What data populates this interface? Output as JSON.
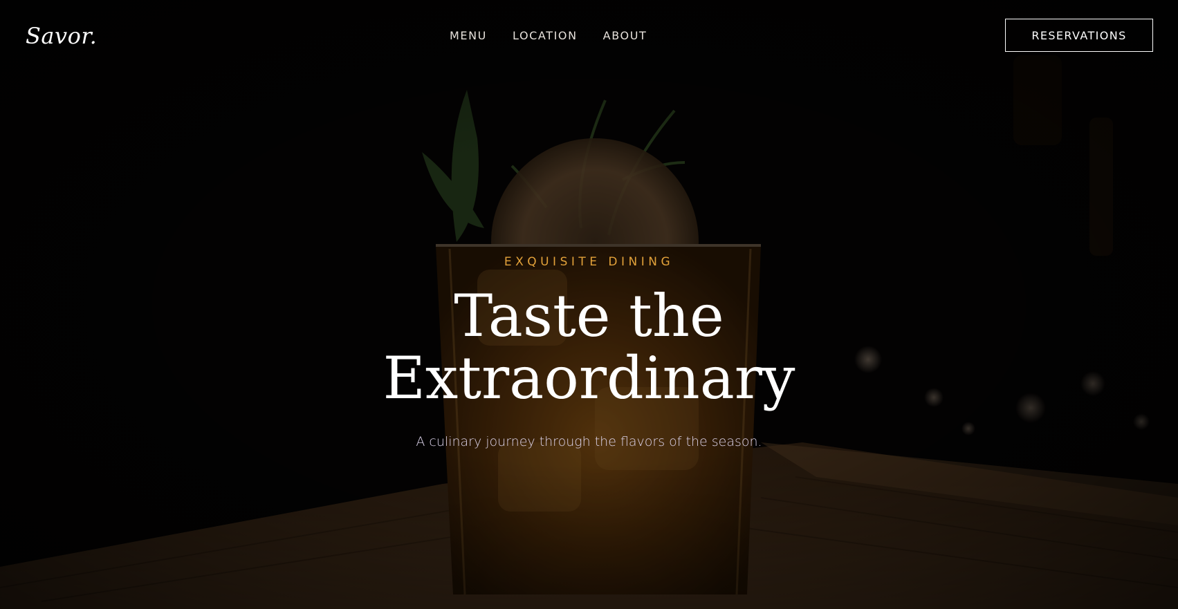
{
  "brand": {
    "logo_text": "Savor."
  },
  "nav": {
    "items": [
      {
        "label": "MENU"
      },
      {
        "label": "LOCATION"
      },
      {
        "label": "ABOUT"
      }
    ]
  },
  "header": {
    "reservations_label": "RESERVATIONS"
  },
  "hero": {
    "eyebrow": "EXQUISITE DINING",
    "headline_line1": "Taste the",
    "headline_line2": "Extraordinary",
    "subtitle": "A culinary journey through the flavors of the season.",
    "background_image": "cocktail-glass-on-wooden-bar",
    "accent_color": "#e3a23a"
  }
}
